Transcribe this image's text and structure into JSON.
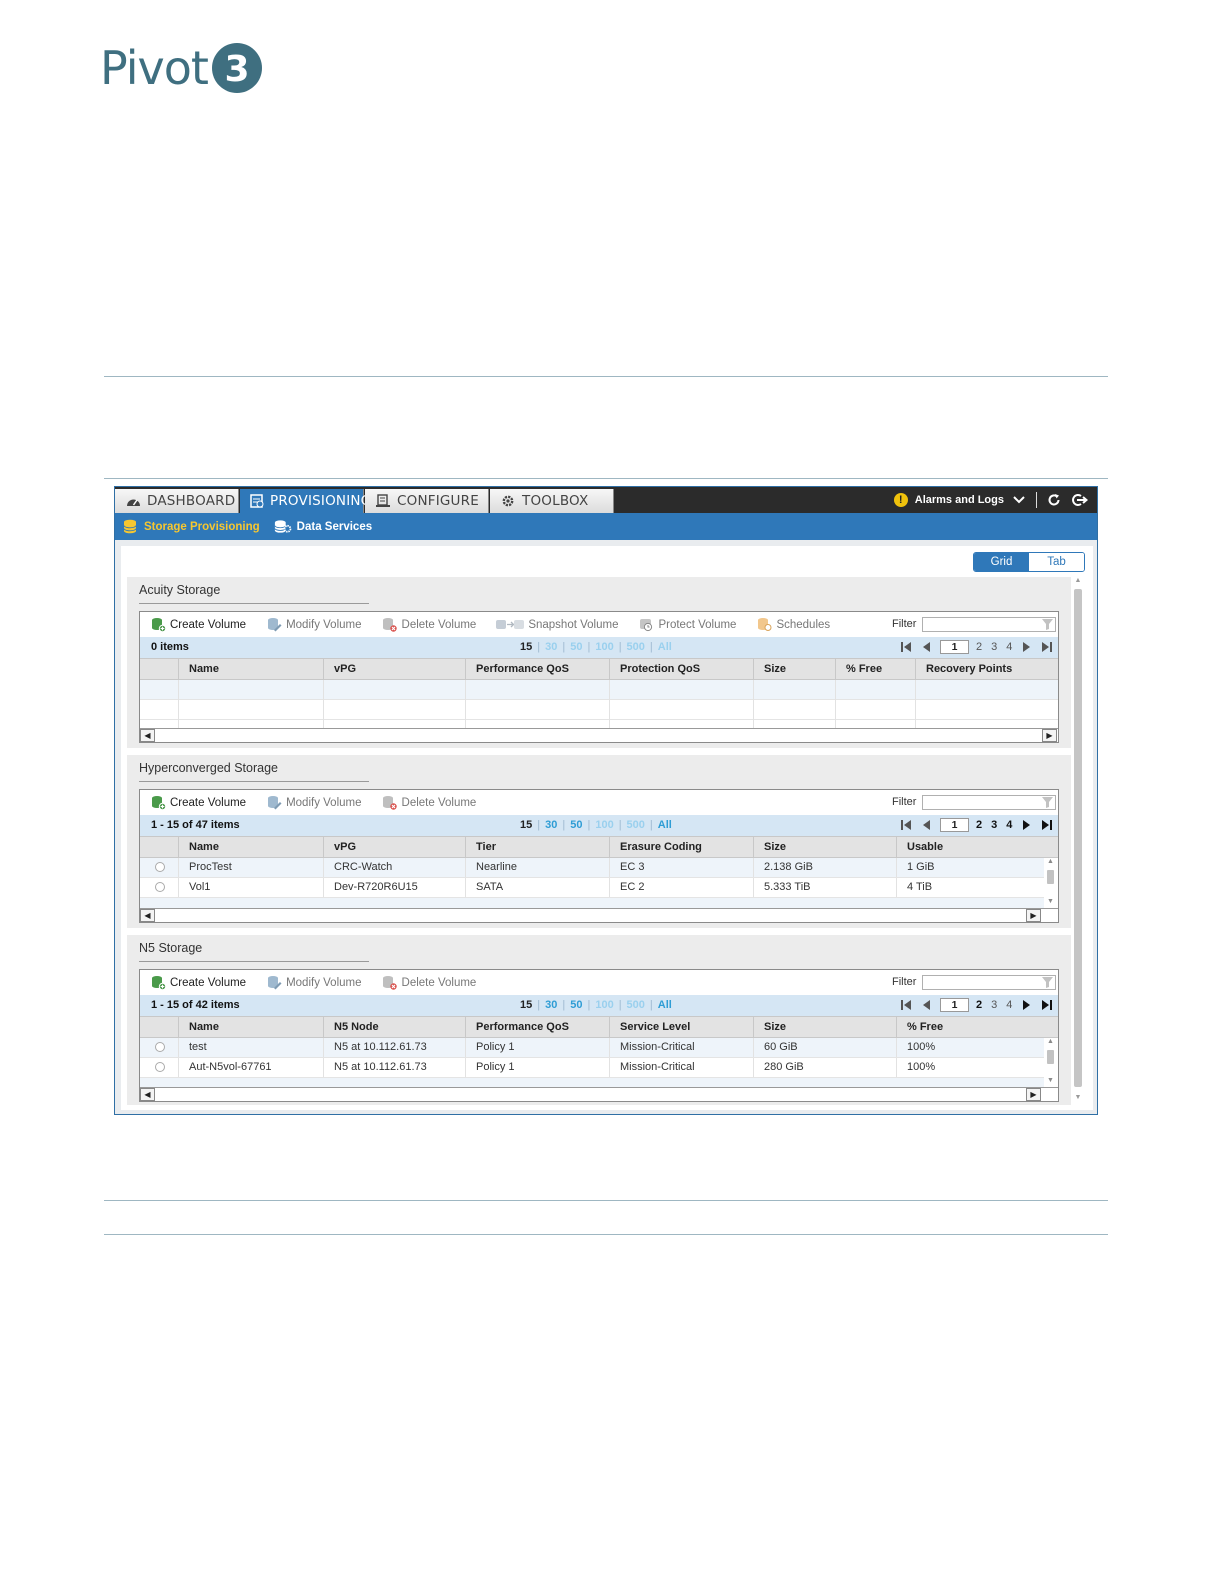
{
  "logo": {
    "text": "Pivot",
    "mark": "3",
    "color": "#3f6f80"
  },
  "topbar": {
    "tabs": [
      {
        "label": "DASHBOARD",
        "icon": "speedometer-icon",
        "active": false
      },
      {
        "label": "PROVISIONING",
        "icon": "provisioning-icon",
        "active": true
      },
      {
        "label": "CONFIGURE",
        "icon": "configure-icon",
        "active": false
      },
      {
        "label": "TOOLBOX",
        "icon": "gear-icon",
        "active": false
      }
    ],
    "alarms_label": "Alarms and Logs",
    "alarm_icon_glyph": "!"
  },
  "subnav": {
    "items": [
      {
        "label": "Storage Provisioning",
        "icon": "database-icon",
        "active": true
      },
      {
        "label": "Data Services",
        "icon": "database-gear-icon",
        "active": false
      }
    ]
  },
  "view_toggle": {
    "grid": "Grid",
    "tab": "Tab",
    "selected": "Grid"
  },
  "colors": {
    "accent": "#2f78b9",
    "topbar": "#2b2b2b",
    "pager": "#d5e6f4",
    "active_sub": "#f7c730",
    "link_blue": "#2f9dd5"
  },
  "common": {
    "filter_label": "Filter",
    "page_sizes": [
      "15",
      "30",
      "50",
      "100",
      "500",
      "All"
    ],
    "current_page": "1",
    "pages": [
      "2",
      "3",
      "4"
    ]
  },
  "acuity": {
    "title": "Acuity Storage",
    "actions": [
      "Create Volume",
      "Modify Volume",
      "Delete Volume",
      "Snapshot Volume",
      "Protect Volume",
      "Schedules"
    ],
    "count": "0 items",
    "columns": [
      "Name",
      "vPG",
      "Performance QoS",
      "Protection QoS",
      "Size",
      "% Free",
      "Recovery Points"
    ],
    "rows": []
  },
  "hyperconverged": {
    "title": "Hyperconverged Storage",
    "actions": [
      "Create Volume",
      "Modify Volume",
      "Delete Volume"
    ],
    "count": "1 - 15 of 47 items",
    "columns": [
      "Name",
      "vPG",
      "Tier",
      "Erasure Coding",
      "Size",
      "Usable"
    ],
    "rows": [
      [
        "ProcTest",
        "CRC-Watch",
        "Nearline",
        "EC 3",
        "2.138 GiB",
        "1 GiB"
      ],
      [
        "Vol1",
        "Dev-R720R6U15",
        "SATA",
        "EC 2",
        "5.333 TiB",
        "4 TiB"
      ]
    ]
  },
  "n5": {
    "title": "N5 Storage",
    "actions": [
      "Create Volume",
      "Modify Volume",
      "Delete Volume"
    ],
    "count": "1 - 15 of 42 items",
    "columns": [
      "Name",
      "N5 Node",
      "Performance QoS",
      "Service Level",
      "Size",
      "% Free"
    ],
    "rows": [
      [
        "test",
        "N5 at 10.112.61.73",
        "Policy 1",
        "Mission-Critical",
        "60 GiB",
        "100%"
      ],
      [
        "Aut-N5vol-67761",
        "N5 at 10.112.61.73",
        "Policy 1",
        "Mission-Critical",
        "280 GiB",
        "100%"
      ]
    ]
  }
}
